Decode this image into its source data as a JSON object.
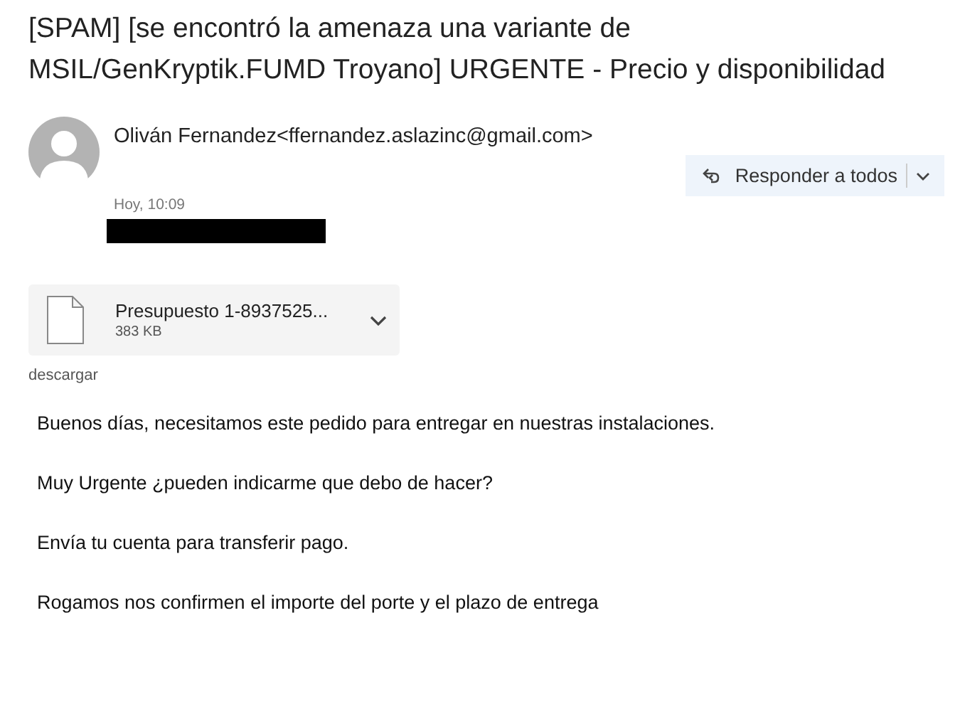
{
  "subject": "[SPAM] [se encontró la amenaza una variante de MSIL/GenKryptik.FUMD Troyano] URGENTE - Precio y disponibilidad",
  "sender": "Oliván Fernandez<ffernandez.aslazinc@gmail.com>",
  "reply_all_button": "Responder a todos",
  "date": "Hoy, 10:09",
  "attachment": {
    "name": "Presupuesto 1-8937525...",
    "size": "383 KB"
  },
  "download_link": "descargar",
  "body": [
    "Buenos días, necesitamos este pedido para entregar en nuestras instalaciones.",
    "Muy Urgente ¿pueden indicarme que debo de hacer?",
    "Envía tu cuenta para transferir pago.",
    "Rogamos nos confirmen el importe del porte y el plazo de entrega"
  ]
}
